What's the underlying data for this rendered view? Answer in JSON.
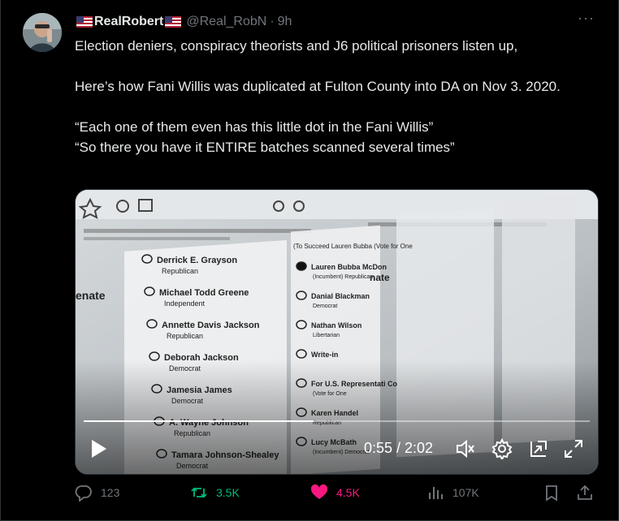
{
  "tweet": {
    "display_name": "RealRobert",
    "handle": "@Real_RobN",
    "separator": "·",
    "time": "9h",
    "more_label": "···",
    "text_lines": [
      "Election deniers, conspiracy theorists and J6 political prisoners listen up,",
      "Here’s how Fani Willis was duplicated at Fulton County into DA on Nov 3. 2020.",
      "“Each one of them even has this little dot in the Fani Willis”",
      "“So there you have it ENTIRE batches scanned several times”"
    ]
  },
  "video": {
    "progress": 0.4545,
    "time_readout": "0:55 / 2:02",
    "ballot_text": {
      "col1": [
        {
          "name": "Derrick E. Grayson",
          "party": "Republican"
        },
        {
          "name": "Michael Todd Greene",
          "party": "Independent"
        },
        {
          "name": "Annette Davis Jackson",
          "party": "Republican"
        },
        {
          "name": "Deborah Jackson",
          "party": "Democrat"
        },
        {
          "name": "Jamesia James",
          "party": "Democrat"
        },
        {
          "name": "A. Wayne Johnson",
          "party": "Republican"
        },
        {
          "name": "Tamara Johnson-Shealey",
          "party": "Democrat"
        }
      ],
      "senate_label": "enate",
      "col2_header": "(To Succeed Lauren Bubba (Vote for One",
      "col2": [
        {
          "name": "Lauren Bubba McDon",
          "party": "(Incumbent) Republican"
        },
        {
          "name": "Danial Blackman",
          "party": "Democrat"
        },
        {
          "name": "Nathan Wilson",
          "party": "Libertarian"
        },
        {
          "name": "Write-in",
          "party": ""
        },
        {
          "name": "For U.S. Representati Congress From t Congressional Distric",
          "party": "(Vote for One"
        },
        {
          "name": "Karen Handel",
          "party": "Republican"
        },
        {
          "name": "Lucy McBath",
          "party": "(Incumbent) Democrat"
        }
      ],
      "nate_label": "nate"
    }
  },
  "actions": {
    "replies": "123",
    "reposts": "3.5K",
    "likes": "4.5K",
    "views": "107K"
  },
  "colors": {
    "repost": "#00ba7c",
    "like": "#f91880",
    "muted": "#71767b"
  },
  "icons": [
    "reply-icon",
    "repost-icon",
    "heart-icon",
    "views-icon",
    "bookmark-icon",
    "share-icon",
    "play-icon",
    "mute-icon",
    "settings-icon",
    "pip-icon",
    "fullscreen-icon"
  ]
}
